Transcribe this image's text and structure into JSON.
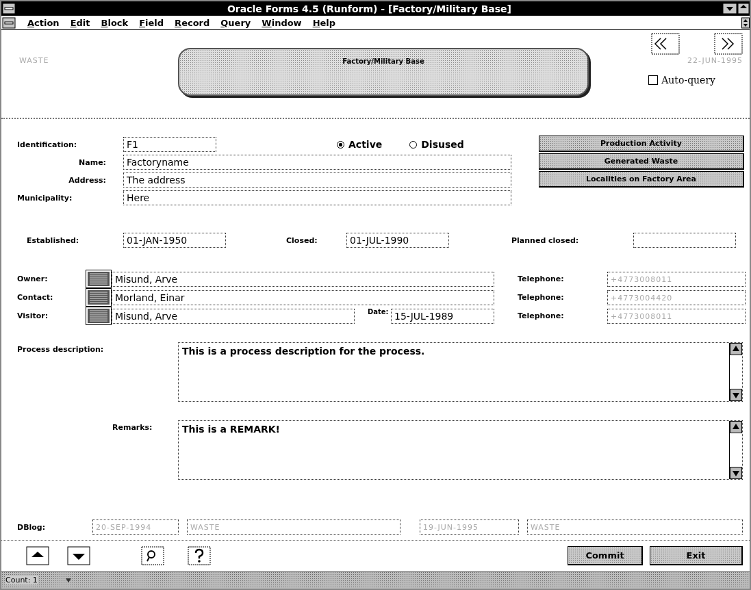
{
  "window": {
    "title": "Oracle Forms 4.5 (Runform) - [Factory/Military Base]"
  },
  "menu": [
    {
      "label": "Action"
    },
    {
      "label": "Edit"
    },
    {
      "label": "Block"
    },
    {
      "label": "Field"
    },
    {
      "label": "Record"
    },
    {
      "label": "Query"
    },
    {
      "label": "Window"
    },
    {
      "label": "Help"
    }
  ],
  "header": {
    "application": {
      "text": "WASTE",
      "disabled": true
    },
    "banner": "Factory/Military Base",
    "date": {
      "text": "22-JUN-1995",
      "disabled": true
    },
    "auto_query": {
      "label": "Auto-query",
      "checked": false
    }
  },
  "identification": {
    "label": "Identification:",
    "value": "F1"
  },
  "status_radios": [
    {
      "label": "Active",
      "selected": true
    },
    {
      "label": "Disused",
      "selected": false
    }
  ],
  "details": [
    {
      "label": "Name:",
      "value": "Factoryname"
    },
    {
      "label": "Address:",
      "value": "The address"
    },
    {
      "label": "Municipality:",
      "value": "Here"
    }
  ],
  "side_buttons": [
    "Production Activity",
    "Generated Waste",
    "Localities on Factory Area"
  ],
  "dates": [
    {
      "label": "Established:",
      "value": "01-JAN-1950"
    },
    {
      "label": "Closed:",
      "value": "01-JUL-1990"
    },
    {
      "label": "Planned closed:"
    }
  ],
  "persons": [
    {
      "label": "Owner:",
      "name": "Misund, Arve",
      "phone_label": "Telephone:",
      "phone": {
        "text": "+4773008011",
        "disabled": true
      }
    },
    {
      "label": "Contact:",
      "name": "Morland, Einar",
      "phone_label": "Telephone:",
      "phone": {
        "text": "+4773004420",
        "disabled": true
      }
    },
    {
      "label": "Visitor:",
      "name": "Misund, Arve",
      "date_label": "Date:",
      "date": "15-JUL-1989",
      "phone_label": "Telephone:",
      "phone": {
        "text": "+4773008011",
        "disabled": true
      }
    }
  ],
  "process_description": {
    "label": "Process description:",
    "value": "This is a process description for the process."
  },
  "remarks": {
    "label": "Remarks:",
    "value": "This is a REMARK!"
  },
  "dblog": {
    "label": "DBlog:",
    "fields": [
      {
        "text": "20-SEP-1994",
        "disabled": true
      },
      {
        "text": "WASTE",
        "disabled": true
      },
      {
        "text": "19-JUN-1995",
        "disabled": true
      },
      {
        "text": "WASTE",
        "disabled": true
      }
    ]
  },
  "action_buttons": [
    "Commit",
    "Exit"
  ],
  "status_bar": {
    "text": "Count: 1"
  }
}
